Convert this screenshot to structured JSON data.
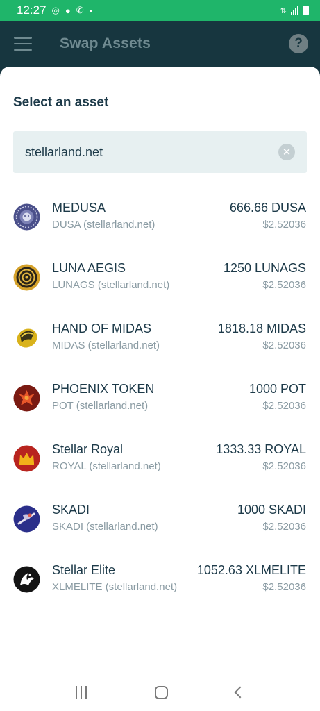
{
  "status": {
    "time": "12:27"
  },
  "header": {
    "title": "Swap Assets",
    "help_label": "?"
  },
  "sheet": {
    "title": "Select an asset",
    "search": {
      "value": "stellarland.net",
      "placeholder": ""
    }
  },
  "assets": [
    {
      "name": "MEDUSA",
      "code": "DUSA (stellarland.net)",
      "amount": "666.66 DUSA",
      "price": "$2.52036",
      "icon": "medusa-logo-icon"
    },
    {
      "name": "LUNA AEGIS",
      "code": "LUNAGS (stellarland.net)",
      "amount": "1250 LUNAGS",
      "price": "$2.52036",
      "icon": "luna-aegis-logo-icon"
    },
    {
      "name": "HAND OF MIDAS",
      "code": "MIDAS (stellarland.net)",
      "amount": "1818.18 MIDAS",
      "price": "$2.52036",
      "icon": "midas-logo-icon"
    },
    {
      "name": "PHOENIX TOKEN",
      "code": "POT (stellarland.net)",
      "amount": "1000 POT",
      "price": "$2.52036",
      "icon": "phoenix-logo-icon"
    },
    {
      "name": "Stellar Royal",
      "code": "ROYAL (stellarland.net)",
      "amount": "1333.33 ROYAL",
      "price": "$2.52036",
      "icon": "crown-logo-icon"
    },
    {
      "name": "SKADI",
      "code": "SKADI (stellarland.net)",
      "amount": "1000 SKADI",
      "price": "$2.52036",
      "icon": "skadi-logo-icon"
    },
    {
      "name": "Stellar Elite",
      "code": "XLMELITE (stellarland.net)",
      "amount": "1052.63 XLMELITE",
      "price": "$2.52036",
      "icon": "elite-logo-icon"
    }
  ],
  "colors": {
    "status_bar": "#1fb56a",
    "header_bg": "#17363f",
    "text_primary": "#1d3a49",
    "text_secondary": "#8a9ba3",
    "search_bg": "#e7f0f1"
  }
}
